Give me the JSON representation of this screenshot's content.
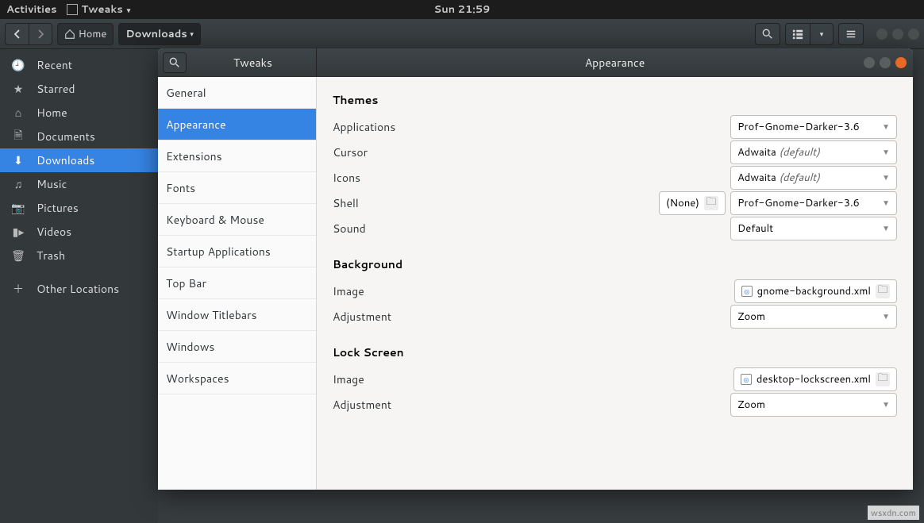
{
  "panel": {
    "activities": "Activities",
    "app_name": "Tweaks",
    "clock": "Sun 21:59"
  },
  "nautilus": {
    "path_home": "Home",
    "path_current": "Downloads",
    "sidebar": {
      "recent": "Recent",
      "starred": "Starred",
      "home": "Home",
      "documents": "Documents",
      "downloads": "Downloads",
      "music": "Music",
      "pictures": "Pictures",
      "videos": "Videos",
      "trash": "Trash",
      "other": "Other Locations"
    }
  },
  "tweaks": {
    "title_left": "Tweaks",
    "title_center": "Appearance",
    "nav": {
      "general": "General",
      "appearance": "Appearance",
      "extensions": "Extensions",
      "fonts": "Fonts",
      "keyboard": "Keyboard & Mouse",
      "startup": "Startup Applications",
      "topbar": "Top Bar",
      "titlebars": "Window Titlebars",
      "windows": "Windows",
      "workspaces": "Workspaces"
    },
    "sections": {
      "themes": "Themes",
      "background": "Background",
      "lockscreen": "Lock Screen"
    },
    "rows": {
      "applications": "Applications",
      "cursor": "Cursor",
      "icons": "Icons",
      "shell": "Shell",
      "sound": "Sound",
      "image": "Image",
      "adjustment": "Adjustment"
    },
    "values": {
      "apps_theme": "Prof-Gnome-Darker-3.6",
      "cursor_theme": "Adwaita",
      "cursor_default": "(default)",
      "icons_theme": "Adwaita",
      "icons_default": "(default)",
      "shell_none": "(None)",
      "shell_theme": "Prof-Gnome-Darker-3.6",
      "sound": "Default",
      "bg_image": "gnome-background.xml",
      "bg_adjust": "Zoom",
      "lock_image": "desktop-lockscreen.xml",
      "lock_adjust": "Zoom"
    }
  },
  "watermark": "wsxdn.com"
}
